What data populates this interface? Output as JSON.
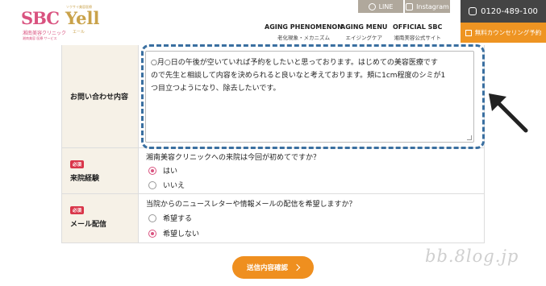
{
  "header": {
    "logo": {
      "brand": "SBC",
      "name": "Yell",
      "tagline": "ソクサイ美容医療",
      "subtitle": "湘南美容クリニック",
      "subline": "湘南美容 医療 サービス",
      "reading": "エール"
    },
    "nav": [
      {
        "en": "AGING PHENOMENON",
        "jp": "老化現象・メカニズム"
      },
      {
        "en": "AGING MENU",
        "jp": "エイジングケア"
      },
      {
        "en": "OFFICIAL SBC",
        "jp": "湘南美容公式サイト"
      }
    ],
    "sns": {
      "line": "LINE",
      "instagram": "Instagram"
    },
    "phone": "0120-489-100",
    "counseling": "無料カウンセリング予約",
    "colors": {
      "pink": "#d9527f",
      "gold": "#c9a24a",
      "orange": "#ef8f1f",
      "dark": "#444444"
    }
  },
  "form": {
    "inquiry": {
      "label": "お問い合わせ内容",
      "lines": [
        "○月○日の午後が空いていれば予約をしたいと思っております。はじめての美容医療です",
        "ので先生と相談して内容を決められると良いなと考えております。頬に1cm程度のシミが1",
        "つ目立つようになり、除去したいです。"
      ]
    },
    "visit": {
      "required": "必須",
      "label": "来院経験",
      "question": "湘南美容クリニックへの来院は今回が初めてですか？",
      "options": [
        {
          "label": "はい",
          "selected": true
        },
        {
          "label": "いいえ",
          "selected": false
        }
      ]
    },
    "mail": {
      "required": "必須",
      "label": "メール配信",
      "question": "当院からのニュースレターや情報メールの配信を希望しますか？",
      "options": [
        {
          "label": "希望する",
          "selected": false
        },
        {
          "label": "希望しない",
          "selected": true
        }
      ]
    }
  },
  "submit_label": "送信内容確認",
  "watermark": "bb.8log.jp"
}
